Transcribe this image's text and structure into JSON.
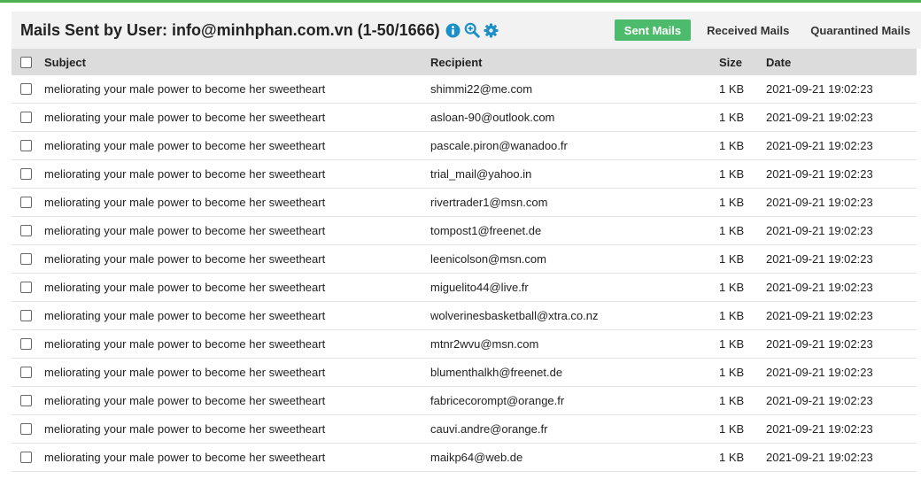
{
  "header": {
    "title": "Mails Sent by User: info@minhphan.com.vn (1-50/1666)",
    "icons": [
      "info-icon",
      "zoom-in-icon",
      "gear-icon"
    ],
    "tabs": [
      {
        "label": "Sent Mails",
        "active": true
      },
      {
        "label": "Received Mails",
        "active": false
      },
      {
        "label": "Quarantined Mails",
        "active": false
      }
    ]
  },
  "colors": {
    "accent": "#4cbb6c",
    "topbar": "#4caf50",
    "header_bg": "#f2f2f2",
    "thead_bg": "#dcdcdc",
    "info": "#1a8fc9"
  },
  "table": {
    "columns": {
      "subject": "Subject",
      "recipient": "Recipient",
      "size": "Size",
      "date": "Date"
    },
    "rows": [
      {
        "subject": "meliorating your male power to become her sweetheart",
        "recipient": "shimmi22@me.com",
        "size": "1 KB",
        "date": "2021-09-21 19:02:23"
      },
      {
        "subject": "meliorating your male power to become her sweetheart",
        "recipient": "asloan-90@outlook.com",
        "size": "1 KB",
        "date": "2021-09-21 19:02:23"
      },
      {
        "subject": "meliorating your male power to become her sweetheart",
        "recipient": "pascale.piron@wanadoo.fr",
        "size": "1 KB",
        "date": "2021-09-21 19:02:23"
      },
      {
        "subject": "meliorating your male power to become her sweetheart",
        "recipient": "trial_mail@yahoo.in",
        "size": "1 KB",
        "date": "2021-09-21 19:02:23"
      },
      {
        "subject": "meliorating your male power to become her sweetheart",
        "recipient": "rivertrader1@msn.com",
        "size": "1 KB",
        "date": "2021-09-21 19:02:23"
      },
      {
        "subject": "meliorating your male power to become her sweetheart",
        "recipient": "tompost1@freenet.de",
        "size": "1 KB",
        "date": "2021-09-21 19:02:23"
      },
      {
        "subject": "meliorating your male power to become her sweetheart",
        "recipient": "leenicolson@msn.com",
        "size": "1 KB",
        "date": "2021-09-21 19:02:23"
      },
      {
        "subject": "meliorating your male power to become her sweetheart",
        "recipient": "miguelito44@live.fr",
        "size": "1 KB",
        "date": "2021-09-21 19:02:23"
      },
      {
        "subject": "meliorating your male power to become her sweetheart",
        "recipient": "wolverinesbasketball@xtra.co.nz",
        "size": "1 KB",
        "date": "2021-09-21 19:02:23"
      },
      {
        "subject": "meliorating your male power to become her sweetheart",
        "recipient": "mtnr2wvu@msn.com",
        "size": "1 KB",
        "date": "2021-09-21 19:02:23"
      },
      {
        "subject": "meliorating your male power to become her sweetheart",
        "recipient": "blumenthalkh@freenet.de",
        "size": "1 KB",
        "date": "2021-09-21 19:02:23"
      },
      {
        "subject": "meliorating your male power to become her sweetheart",
        "recipient": "fabricecorompt@orange.fr",
        "size": "1 KB",
        "date": "2021-09-21 19:02:23"
      },
      {
        "subject": "meliorating your male power to become her sweetheart",
        "recipient": "cauvi.andre@orange.fr",
        "size": "1 KB",
        "date": "2021-09-21 19:02:23"
      },
      {
        "subject": "meliorating your male power to become her sweetheart",
        "recipient": "maikp64@web.de",
        "size": "1 KB",
        "date": "2021-09-21 19:02:23"
      }
    ]
  }
}
